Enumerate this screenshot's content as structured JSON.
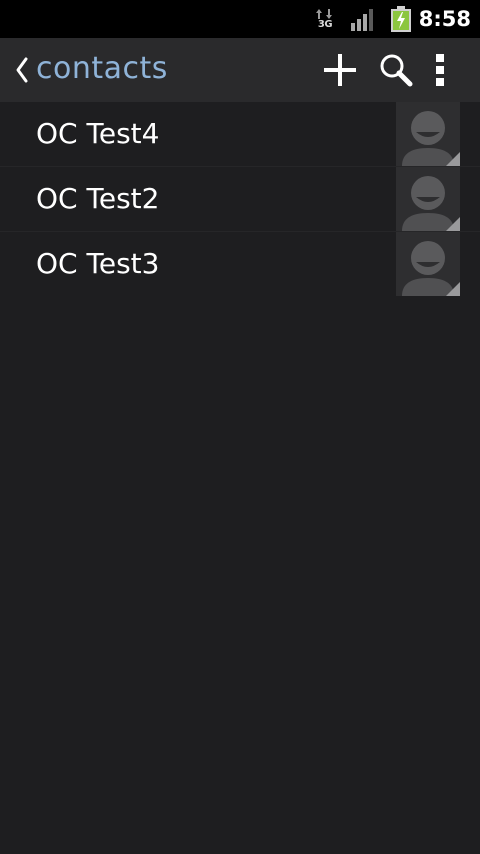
{
  "status_bar": {
    "network_type": "3G",
    "time": "8:58",
    "battery_color": "#8cc63f"
  },
  "action_bar": {
    "title": "contacts",
    "title_color": "#8fb3d8",
    "icons": [
      "back-icon",
      "add-icon",
      "search-icon",
      "overflow-menu-icon"
    ]
  },
  "contacts": [
    {
      "name": "OC Test4",
      "avatar_icon": "default-avatar-icon"
    },
    {
      "name": "OC Test2",
      "avatar_icon": "default-avatar-icon"
    },
    {
      "name": "OC Test3",
      "avatar_icon": "default-avatar-icon"
    }
  ]
}
